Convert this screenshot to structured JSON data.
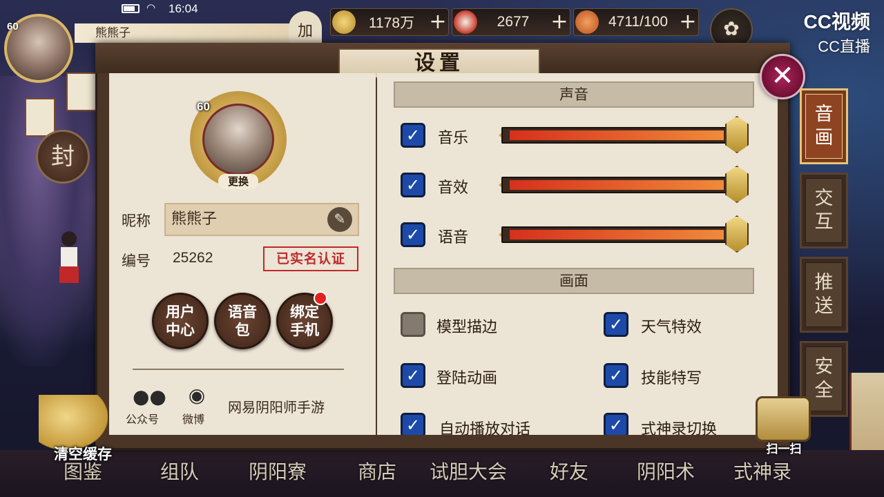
{
  "status": {
    "time": "16:04"
  },
  "player": {
    "level": "60",
    "name": "熊熊子"
  },
  "top_button": "加",
  "resources": [
    {
      "icon": "coin-icon",
      "value": "1178万",
      "color": "#d8b24a"
    },
    {
      "icon": "jade-icon",
      "value": "2677",
      "color": "#c83a2a"
    },
    {
      "icon": "stamina-icon",
      "value": "4711/100",
      "color": "#e07a30"
    }
  ],
  "watermark": {
    "line1": "CC视频",
    "line2": "CC直播"
  },
  "seal_badge": "封",
  "panel": {
    "title": "设置",
    "close_glyph": "✕"
  },
  "profile": {
    "level": "60",
    "change_avatar": "更换",
    "nickname_label": "昵称",
    "nickname": "熊熊子",
    "id_label": "编号",
    "id_value": "25262",
    "verified": "已实名认证",
    "buttons": {
      "user_center": "用户中心",
      "voice_pack": "语音包",
      "bind_phone": "绑定手机"
    },
    "social": {
      "wechat_label": "公众号",
      "weibo_label": "微博",
      "game_name": "网易阴阳师手游"
    }
  },
  "sound": {
    "header": "声音",
    "rows": [
      {
        "label": "音乐",
        "checked": true,
        "level": 1.0
      },
      {
        "label": "音效",
        "checked": true,
        "level": 1.0
      },
      {
        "label": "语音",
        "checked": true,
        "level": 1.0
      }
    ]
  },
  "graphics": {
    "header": "画面",
    "options": [
      {
        "label": "模型描边",
        "checked": false
      },
      {
        "label": "天气特效",
        "checked": true
      },
      {
        "label": "登陆动画",
        "checked": true
      },
      {
        "label": "技能特写",
        "checked": true
      },
      {
        "label": "自动播放对话",
        "checked": true
      },
      {
        "label": "式神录切换",
        "checked": true
      }
    ]
  },
  "side_tabs": [
    {
      "label": "音画",
      "active": true
    },
    {
      "label": "交互",
      "active": false
    },
    {
      "label": "推送",
      "active": false
    },
    {
      "label": "安全",
      "active": false
    }
  ],
  "scan_label": "扫一扫",
  "clear_cache_label": "清空缓存",
  "bottom_nav": [
    "图鉴",
    "组队",
    "阴阳寮",
    "商店",
    "试胆大会",
    "好友",
    "阴阳术",
    "式神录"
  ],
  "colors": {
    "accent_blue": "#1d4aa8",
    "slider_fill": "#e8542a",
    "stamp_red": "#c0282a"
  }
}
